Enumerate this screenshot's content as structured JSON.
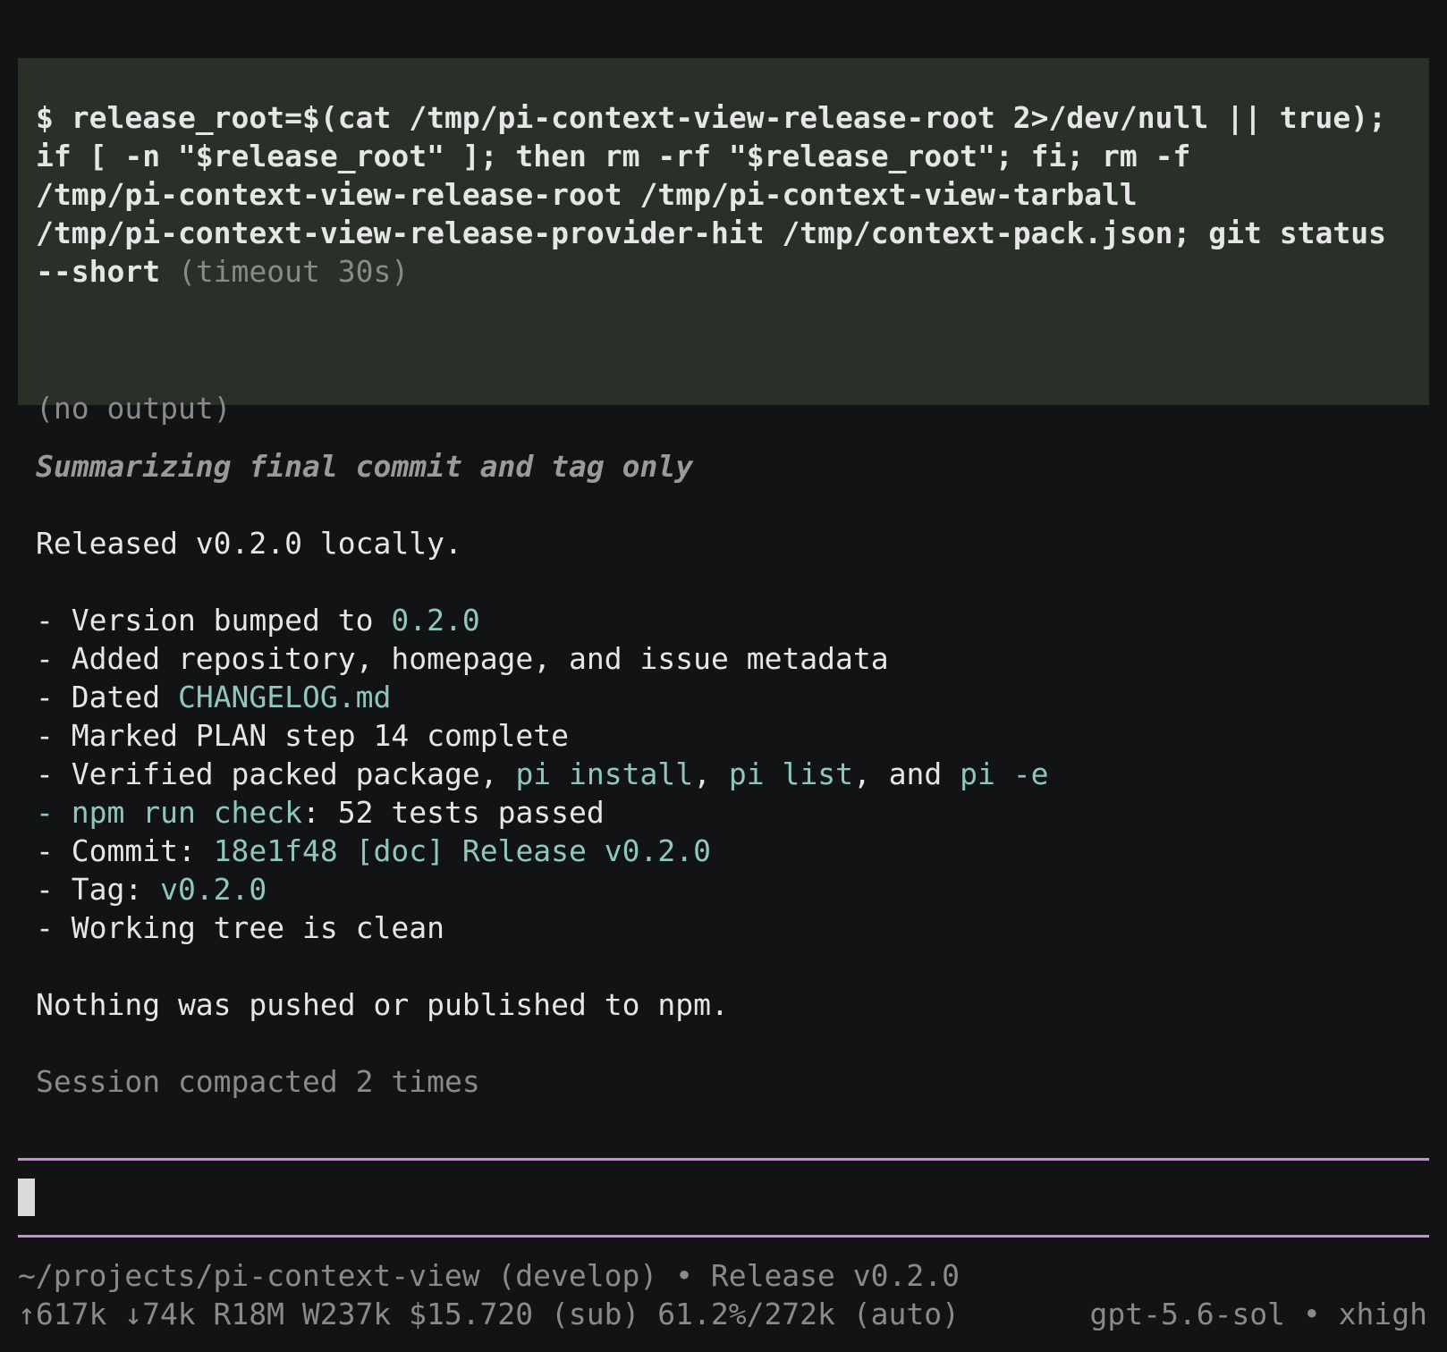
{
  "tool_call": {
    "command_lines": [
      "$ release_root=$(cat /tmp/pi-context-view-release-root 2>/dev/null || true);",
      "if [ -n \"$release_root\" ]; then rm -rf \"$release_root\"; fi; rm -f",
      "/tmp/pi-context-view-release-root /tmp/pi-context-view-tarball",
      "/tmp/pi-context-view-release-provider-hit /tmp/context-pack.json; git status"
    ],
    "last_line_cmd": "--short",
    "timeout": " (timeout 30s)",
    "output": "(no output)"
  },
  "assistant": {
    "thinking": "Summarizing final commit and tag only",
    "intro": "Released v0.2.0 locally.",
    "bullets": {
      "b1_text": "- Version bumped to ",
      "b1_code": "0.2.0",
      "b2_text": "- Added repository, homepage, and issue metadata",
      "b3_text": "- Dated ",
      "b3_code": "CHANGELOG.md",
      "b4_text": "- Marked PLAN step 14 complete",
      "b5_text": "- Verified packed package, ",
      "b5_code1": "pi install",
      "b5_sep1": ", ",
      "b5_code2": "pi list",
      "b5_sep2": ", and ",
      "b5_code3": "pi -e",
      "b6_dash": "- ",
      "b6_code": "npm run check",
      "b6_text": ": 52 tests passed",
      "b7_text": "- Commit: ",
      "b7_code": "18e1f48 [doc] Release v0.2.0",
      "b8_text": "- Tag: ",
      "b8_code": "v0.2.0",
      "b9_text": "- Working tree is clean"
    },
    "outro": "Nothing was pushed or published to npm."
  },
  "status": {
    "compaction": "Session compacted 2 times"
  },
  "footer": {
    "path_line": "~/projects/pi-context-view (develop) • Release v0.2.0",
    "stats_line": "↑617k ↓74k R18M W237k $15.720 (sub) 61.2%/272k (auto)",
    "model_line": "gpt-5.6-sol • xhigh"
  },
  "colors": {
    "background": "#121315",
    "tool_block": "#283028",
    "accent": "#8fc7c0",
    "rule": "#c98fd6"
  }
}
